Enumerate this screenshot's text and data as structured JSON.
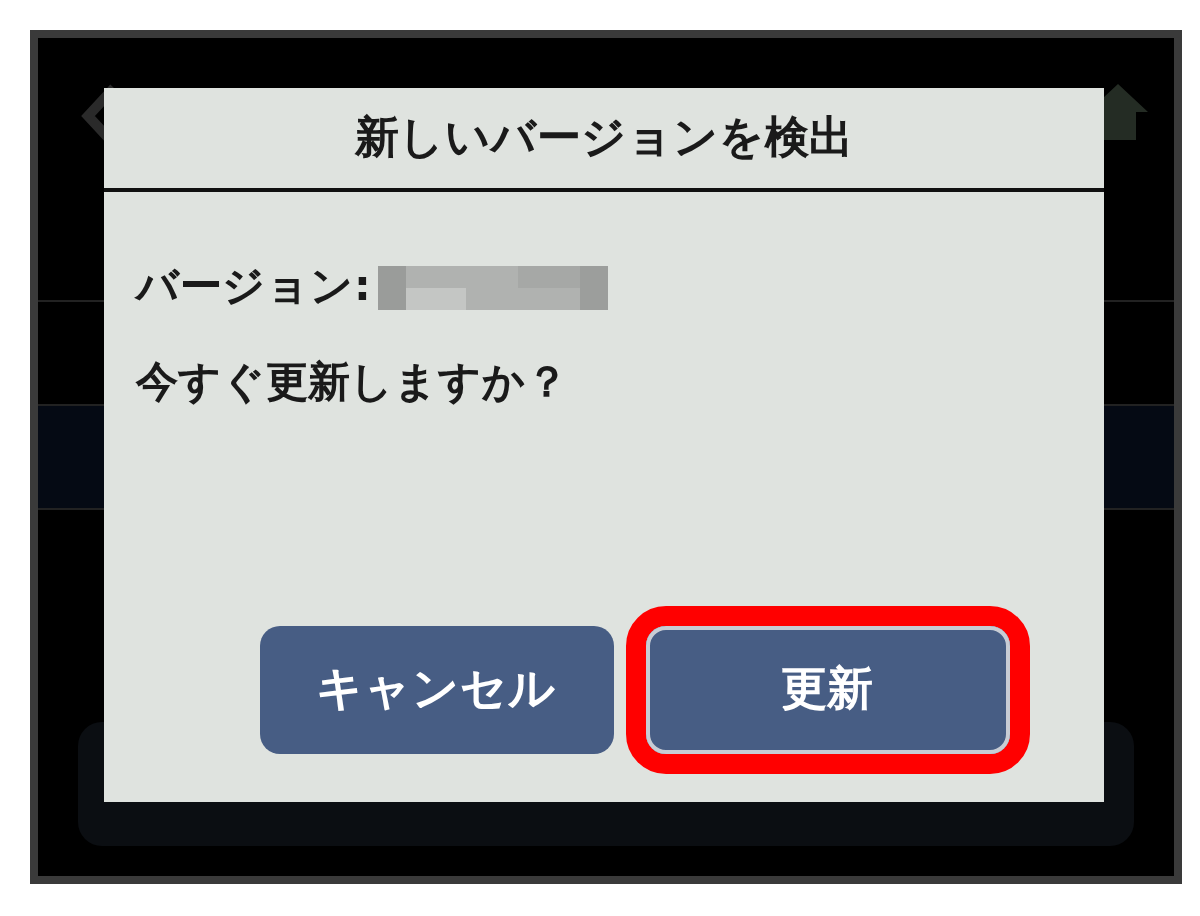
{
  "dialog": {
    "title": "新しいバージョンを検出",
    "version_label": "バージョン:",
    "message": "今すぐ更新しますか？",
    "buttons": [
      {
        "label": "キャンセル",
        "highlighted": false
      },
      {
        "label": "更新",
        "highlighted": true
      }
    ]
  }
}
